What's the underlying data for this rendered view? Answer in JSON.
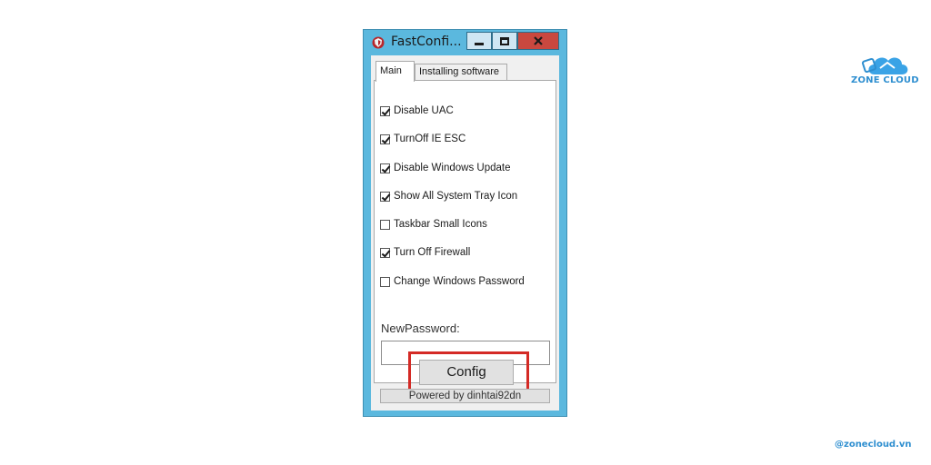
{
  "window": {
    "title": "FastConfi...",
    "buttons": {
      "minimize": "minimize",
      "maximize": "maximize",
      "close": "x"
    }
  },
  "tabs": [
    {
      "label": "Main",
      "active": true
    },
    {
      "label": "Installing software",
      "active": false
    }
  ],
  "options": [
    {
      "label": "Disable UAC",
      "checked": true
    },
    {
      "label": "TurnOff IE ESC",
      "checked": true
    },
    {
      "label": "Disable Windows Update",
      "checked": true
    },
    {
      "label": "Show All System Tray Icon",
      "checked": true
    },
    {
      "label": "Taskbar Small Icons",
      "checked": false
    },
    {
      "label": "Turn Off Firewall",
      "checked": true
    },
    {
      "label": "Change Windows Password",
      "checked": false
    }
  ],
  "password": {
    "label": "NewPassword:",
    "value": ""
  },
  "config_button": "Config",
  "footer": "Powered by dinhtai92dn",
  "brand": {
    "logo_text": "ZONE CLOUD",
    "handle": "@zonecloud.vn",
    "color": "#2f8fd0"
  },
  "colors": {
    "frame": "#5bb8de",
    "close": "#c9483f",
    "highlight": "#d42a25"
  }
}
